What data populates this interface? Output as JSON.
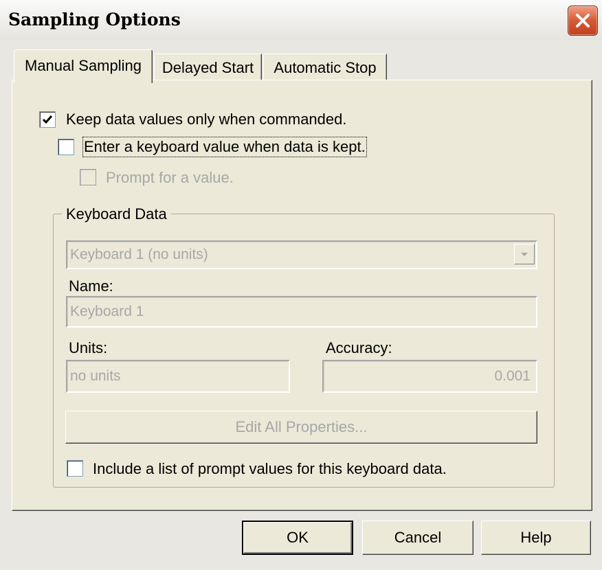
{
  "window": {
    "title": "Sampling Options"
  },
  "tabs": [
    {
      "label": "Manual Sampling",
      "active": true
    },
    {
      "label": "Delayed Start",
      "active": false
    },
    {
      "label": "Automatic Stop",
      "active": false
    }
  ],
  "options": {
    "keep_values": {
      "label": "Keep data values only when commanded.",
      "checked": true
    },
    "enter_keyboard": {
      "label": "Enter a keyboard value when data is kept.",
      "checked": false
    },
    "prompt_value": {
      "label": "Prompt for a value.",
      "checked": false,
      "disabled": true
    }
  },
  "keyboard_data": {
    "group_label": "Keyboard Data",
    "selected": "Keyboard 1 (no units)",
    "name_label": "Name:",
    "name_value": "Keyboard 1",
    "units_label": "Units:",
    "units_value": "no units",
    "accuracy_label": "Accuracy:",
    "accuracy_value": "0.001",
    "edit_button": "Edit All Properties...",
    "include_list": {
      "label": "Include a list of prompt values for this keyboard data.",
      "checked": false
    }
  },
  "buttons": {
    "ok": "OK",
    "cancel": "Cancel",
    "help": "Help"
  },
  "colors": {
    "close_button": "#d85a32",
    "disabled_text": "#a7a7a7",
    "dialog_bg": "#ece9d8"
  },
  "icons": {
    "close": "close-icon",
    "check": "check-icon",
    "dropdown": "chevron-down-icon"
  }
}
